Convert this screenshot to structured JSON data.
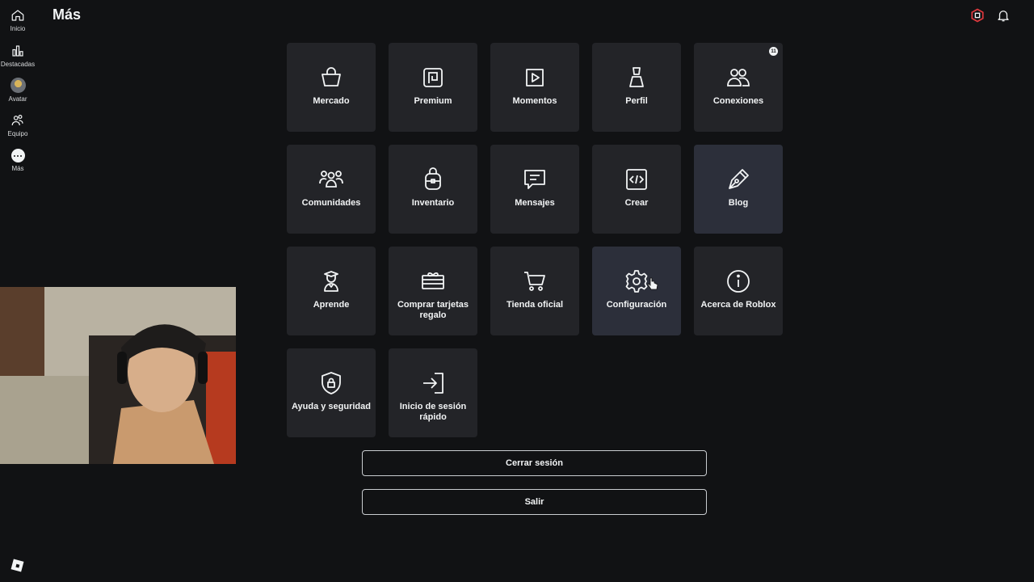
{
  "header": {
    "title": "Más"
  },
  "sidebar": {
    "items": [
      {
        "label": "Inicio",
        "icon": "home-icon"
      },
      {
        "label": "Destacadas",
        "icon": "charts-icon"
      },
      {
        "label": "Avatar",
        "icon": "avatar-icon"
      },
      {
        "label": "Equipo",
        "icon": "party-icon"
      },
      {
        "label": "Más",
        "icon": "more-icon"
      }
    ]
  },
  "grid": {
    "tiles": [
      {
        "label": "Mercado",
        "icon": "shopping-bag-icon"
      },
      {
        "label": "Premium",
        "icon": "premium-icon"
      },
      {
        "label": "Momentos",
        "icon": "moments-icon"
      },
      {
        "label": "Perfil",
        "icon": "profile-icon"
      },
      {
        "label": "Conexiones",
        "icon": "connections-icon",
        "badge": "11"
      },
      {
        "label": "Comunidades",
        "icon": "communities-icon"
      },
      {
        "label": "Inventario",
        "icon": "inventory-icon"
      },
      {
        "label": "Mensajes",
        "icon": "messages-icon"
      },
      {
        "label": "Crear",
        "icon": "code-icon"
      },
      {
        "label": "Blog",
        "icon": "pen-icon"
      },
      {
        "label": "Aprende",
        "icon": "learn-icon"
      },
      {
        "label": "Comprar tarjetas regalo",
        "icon": "gift-card-icon"
      },
      {
        "label": "Tienda oficial",
        "icon": "cart-icon"
      },
      {
        "label": "Configuración",
        "icon": "gear-icon"
      },
      {
        "label": "Acerca de Roblox",
        "icon": "info-icon"
      },
      {
        "label": "Ayuda y seguridad",
        "icon": "shield-lock-icon"
      },
      {
        "label": "Inicio de sesión rápido",
        "icon": "sign-in-icon"
      }
    ]
  },
  "actions": {
    "logout_label": "Cerrar sesión",
    "exit_label": "Salir"
  },
  "colors": {
    "background": "#111214",
    "tile": "#232428",
    "tile_active": "#2c2f3a",
    "text": "#f2f4f5",
    "robux_accent": "#e0393e"
  }
}
